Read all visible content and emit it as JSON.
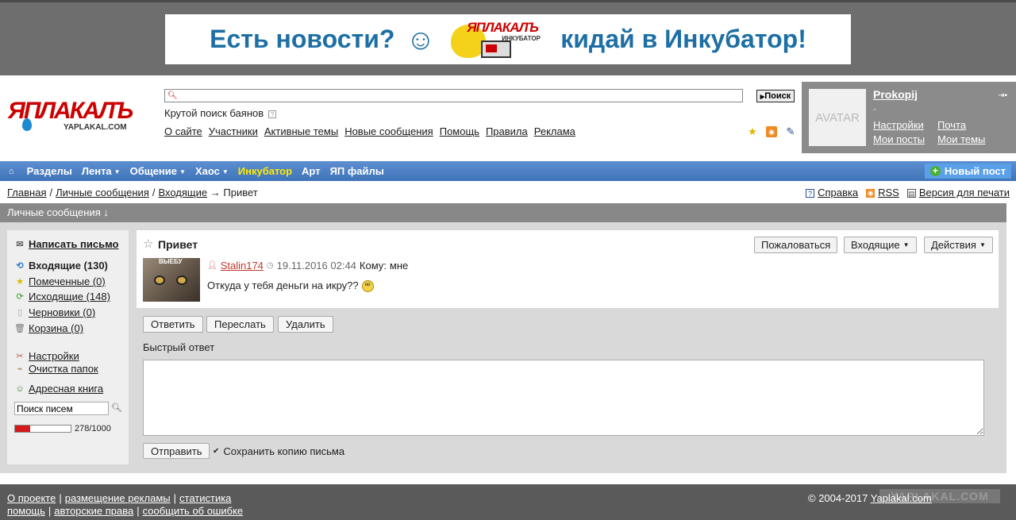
{
  "banner": {
    "text_left": "Есть новости?",
    "logo_text": "ЯПЛАКАЛЪ",
    "logo_sub": "ИНКУБАТОР",
    "text_right": "кидай в Инкубатор!"
  },
  "header": {
    "logo_text": "ЯПЛАКАЛЪ",
    "logo_sub": "YAPLAKAL.COM",
    "search_value": "",
    "search_button": "Поиск",
    "search_hint": "Крутой поиск баянов",
    "search_hint_help": "?",
    "links": [
      "О сайте",
      "Участники",
      "Активные темы",
      "Новые сообщения",
      "Помощь",
      "Правила",
      "Реклама"
    ]
  },
  "user": {
    "avatar_text": "AVATAR",
    "name": "Prokopij",
    "dash": "-",
    "settings": "Настройки",
    "mail": "Почта",
    "my_posts": "Мои посты",
    "my_topics": "Мои темы"
  },
  "nav": {
    "items": [
      {
        "label": "Разделы",
        "caret": false
      },
      {
        "label": "Лента",
        "caret": true
      },
      {
        "label": "Общение",
        "caret": true
      },
      {
        "label": "Хаос",
        "caret": true
      },
      {
        "label": "Инкубатор",
        "caret": false
      },
      {
        "label": "Арт",
        "caret": false
      },
      {
        "label": "ЯП файлы",
        "caret": false
      }
    ],
    "new_post": "Новый пост"
  },
  "breadcrumb": {
    "home": "Главная",
    "pm": "Личные сообщения",
    "inbox": "Входящие",
    "arrow": "→",
    "current": "Привет",
    "sep": "/"
  },
  "right_links": {
    "help": "Справка",
    "rss": "RSS",
    "print": "Версия для печати"
  },
  "panel": {
    "title": "Личные сообщения ↓"
  },
  "sidebar": {
    "compose": "Написать письмо",
    "inbox": "Входящие (130)",
    "starred": "Помеченные (0)",
    "outbox": "Исходящие (148)",
    "drafts": "Черновики (0)",
    "trash": "Корзина (0)",
    "settings": "Настройки",
    "cleanup": "Очистка папок",
    "address_book": "Адресная книга",
    "search_value": "Поиск писем",
    "quota_text": "278/1000",
    "quota_used": 278,
    "quota_total": 1000
  },
  "message": {
    "title": "Привет",
    "complain": "Пожаловаться",
    "folder": "Входящие",
    "actions": "Действия",
    "avatar_caption": "ВЫЕБУ",
    "author": "Stalin174",
    "date": "19.11.2016 02:44",
    "to_label": "Кому:",
    "to": "мне",
    "text": "Откуда у тебя деньги на икру??"
  },
  "actions": {
    "reply": "Ответить",
    "forward": "Переслать",
    "delete": "Удалить",
    "quick_reply_label": "Быстрый ответ",
    "quick_reply_value": "",
    "send": "Отправить",
    "save_copy": "Сохранить копию письма"
  },
  "footer": {
    "row1": [
      "О проекте",
      "размещение рекламы",
      "статистика"
    ],
    "row2": [
      "помощь",
      "авторские права",
      "сообщить об ошибке"
    ],
    "copyright": "© 2004-2017",
    "site": "Yaplakal.com",
    "watermark": "YAPLAKAL.COM"
  },
  "colors": {
    "nav_blue": "#4a7fc4",
    "incubator_yellow": "#ffea00",
    "panel_gray": "#888888",
    "author_red": "#c0392b",
    "quota_red": "#d41a1a"
  }
}
